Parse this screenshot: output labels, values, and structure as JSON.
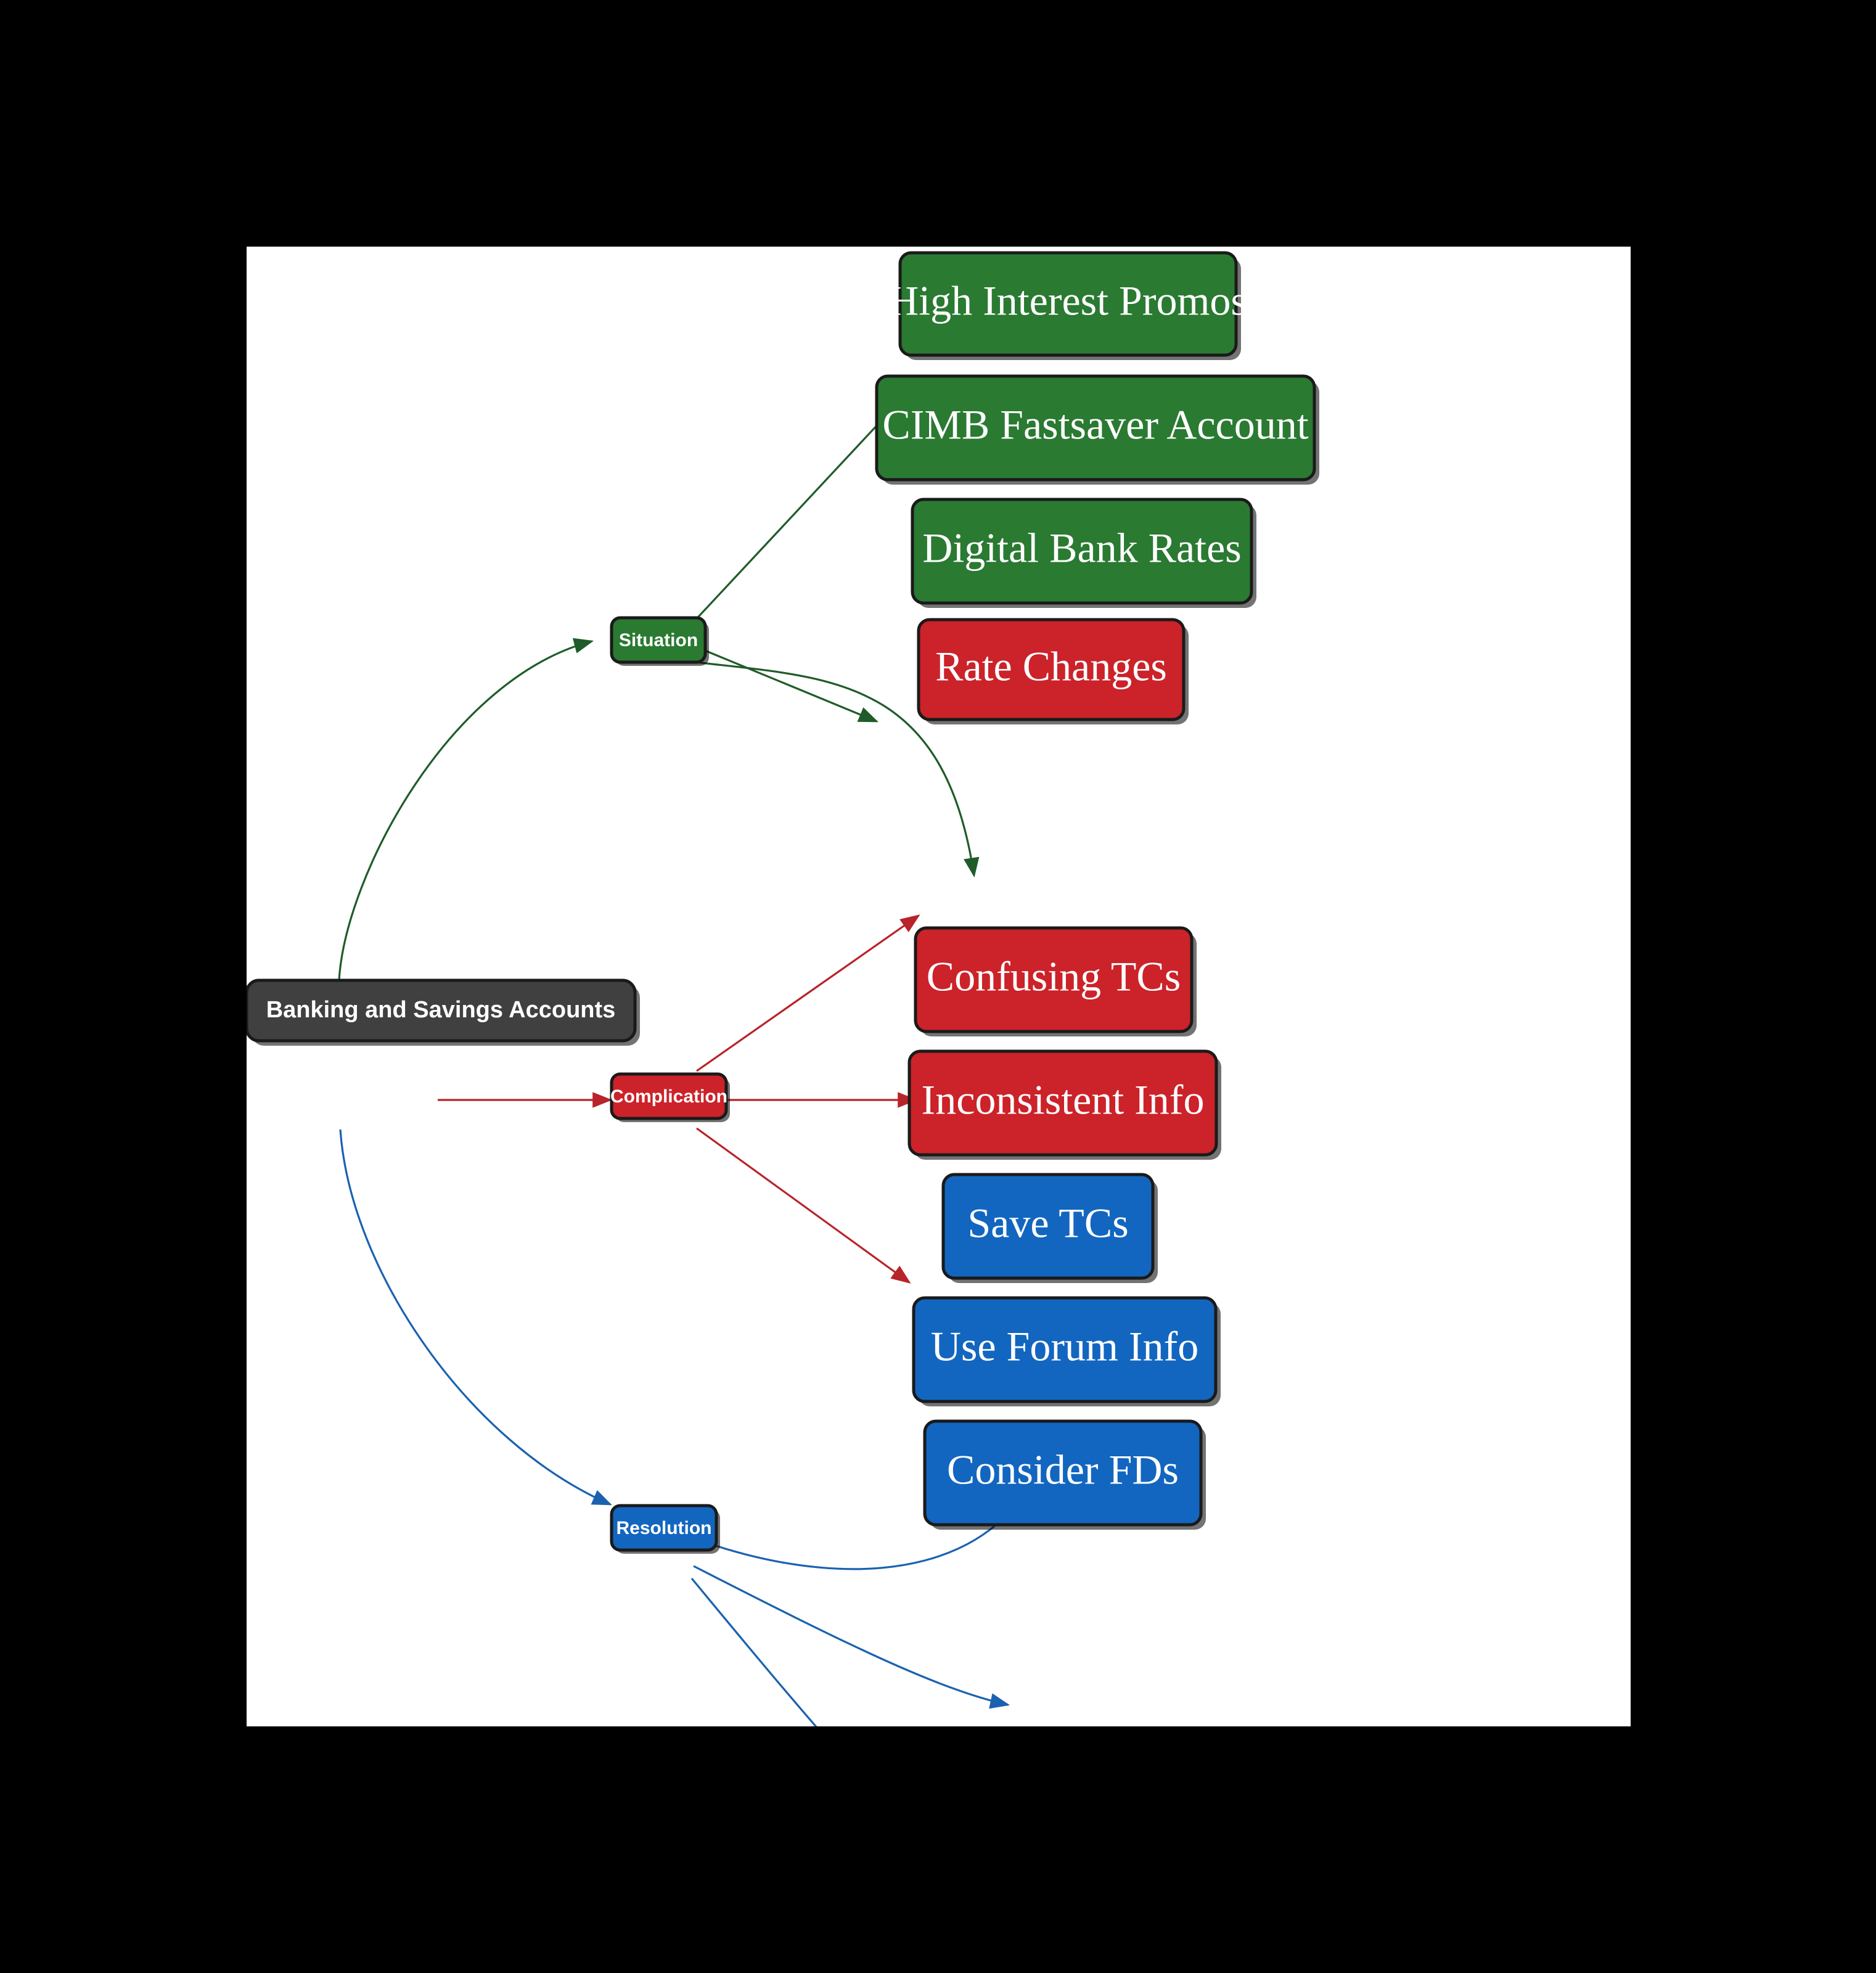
{
  "canvas": {
    "background": "#000000",
    "surface": "#ffffff"
  },
  "diagram": {
    "type": "mind-map",
    "title": "Banking and Savings Accounts",
    "root": {
      "id": "root",
      "label": "Banking and Savings Accounts",
      "color": "#404040",
      "text_color": "#ffffff"
    },
    "branches": [
      {
        "id": "situation",
        "label": "Situation",
        "color": "#2a7a32",
        "edge_color": "#1f5c29",
        "text_color": "#ffffff",
        "children": [
          {
            "id": "high-interest-promos",
            "label": "High Interest Promos",
            "color": "#2a7a32"
          },
          {
            "id": "cimb-fastsaver-account",
            "label": "CIMB Fastsaver Account",
            "color": "#2a7a32"
          },
          {
            "id": "digital-bank-rates",
            "label": "Digital Bank Rates",
            "color": "#2a7a32"
          }
        ]
      },
      {
        "id": "complication",
        "label": "Complication",
        "color": "#cc2229",
        "edge_color": "#b8242a",
        "text_color": "#ffffff",
        "children": [
          {
            "id": "rate-changes",
            "label": "Rate Changes",
            "color": "#cc2229"
          },
          {
            "id": "confusing-tcs",
            "label": "Confusing TCs",
            "color": "#cc2229"
          },
          {
            "id": "inconsistent-info",
            "label": "Inconsistent Info",
            "color": "#cc2229"
          }
        ]
      },
      {
        "id": "resolution",
        "label": "Resolution",
        "color": "#1266bf",
        "edge_color": "#1a62b0",
        "text_color": "#ffffff",
        "children": [
          {
            "id": "save-tcs",
            "label": "Save TCs",
            "color": "#1266bf"
          },
          {
            "id": "use-forum-info",
            "label": "Use Forum Info",
            "color": "#1266bf"
          },
          {
            "id": "consider-fds",
            "label": "Consider FDs",
            "color": "#1266bf"
          }
        ]
      }
    ]
  }
}
